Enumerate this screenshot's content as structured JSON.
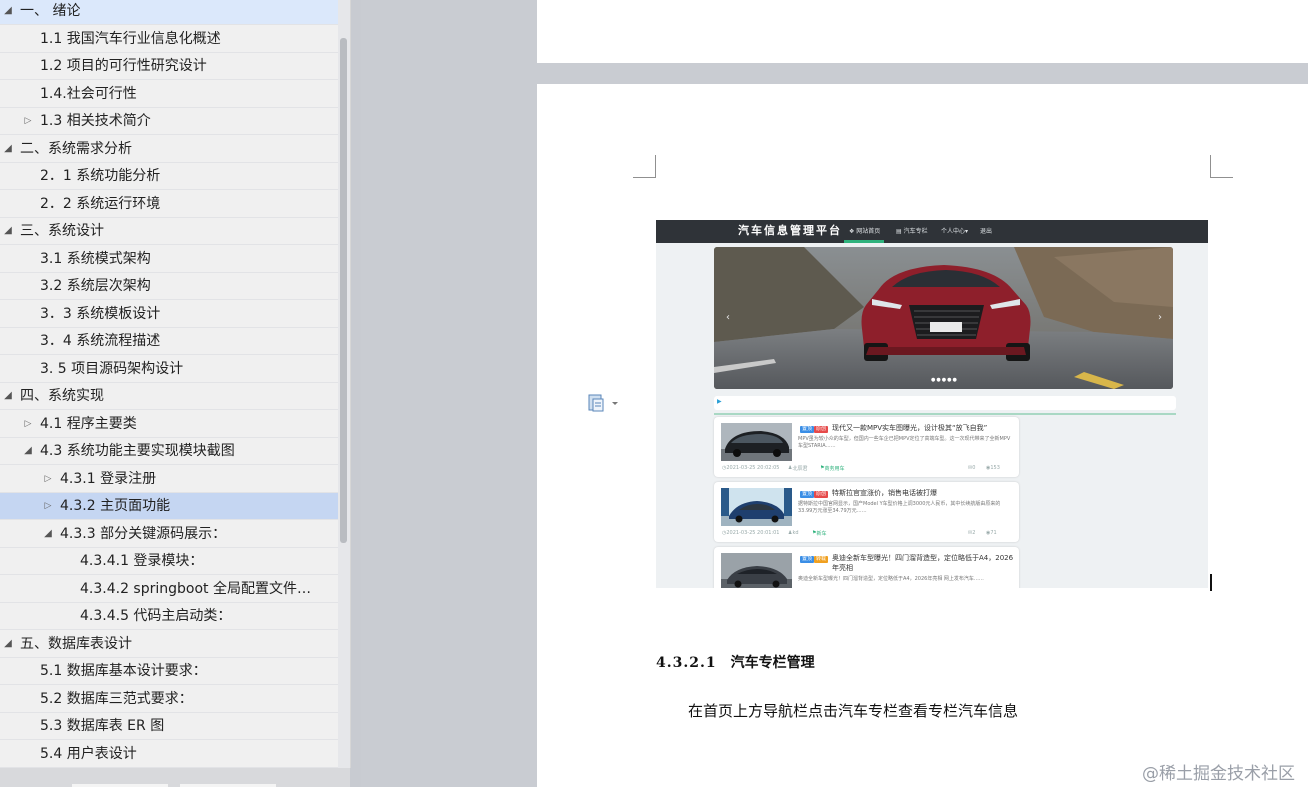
{
  "navigation": {
    "items": [
      {
        "label": "一、 绪论",
        "toggle": "open"
      },
      {
        "label": "1.1  我国汽车行业信息化概述",
        "toggle": "none"
      },
      {
        "label": "1.2 项目的可行性研究设计",
        "toggle": "none"
      },
      {
        "label": "1.4.社会可行性",
        "toggle": "none"
      },
      {
        "label": "1.3 相关技术简介",
        "toggle": "closed"
      },
      {
        "label": "二、系统需求分析",
        "toggle": "open"
      },
      {
        "label": "2．1 系统功能分析",
        "toggle": "none"
      },
      {
        "label": "2．2 系统运行环境",
        "toggle": "none"
      },
      {
        "label": "三、系统设计",
        "toggle": "open"
      },
      {
        "label": "3.1  系统模式架构",
        "toggle": "none"
      },
      {
        "label": "3.2  系统层次架构",
        "toggle": "none"
      },
      {
        "label": "3．3 系统模板设计",
        "toggle": "none"
      },
      {
        "label": "3．4 系统流程描述",
        "toggle": "none"
      },
      {
        "label": "3. 5 项目源码架构设计",
        "toggle": "none"
      },
      {
        "label": "四、系统实现",
        "toggle": "open"
      },
      {
        "label": "4.1  程序主要类",
        "toggle": "closed"
      },
      {
        "label": "4.3 系统功能主要实现模块截图",
        "toggle": "open"
      },
      {
        "label": "4.3.1 登录注册",
        "toggle": "closed"
      },
      {
        "label": "4.3.2  主页面功能",
        "toggle": "closed",
        "selected": true
      },
      {
        "label": "4.3.3 部分关键源码展示：",
        "toggle": "open"
      },
      {
        "label": "4.3.4.1 登录模块：",
        "toggle": "none"
      },
      {
        "label": "4.3.4.2 springboot 全局配置文件…",
        "toggle": "none"
      },
      {
        "label": "4.3.4.5 代码主启动类：",
        "toggle": "none"
      },
      {
        "label": "五、数据库表设计",
        "toggle": "open"
      },
      {
        "label": "5.1 数据库基本设计要求：",
        "toggle": "none"
      },
      {
        "label": "5.2 数据库三范式要求：",
        "toggle": "none"
      },
      {
        "label": "5.3 数据库表 ER 图",
        "toggle": "none"
      },
      {
        "label": "5.4 用户表设计",
        "toggle": "none"
      }
    ]
  },
  "figure": {
    "brand": "汽车信息管理平台",
    "nav": [
      "网站首页",
      "汽车专栏",
      "个人中心▾",
      "退出"
    ],
    "cards": [
      {
        "badges": [
          "置顶",
          "原创"
        ],
        "title": "现代又一款MPV实车图曝光，设计极其“放飞自我”",
        "desc": "MPV虽为较小众的车型，但国内一些车企已把MPV定位了高端车型。这一次现代带来了全新MPV车型STARIA……",
        "date": "2021-03-25 20:02:05",
        "author": "北辰君",
        "tag": "商务用车",
        "comments": "0",
        "views": "153"
      },
      {
        "badges": [
          "置顶",
          "原创"
        ],
        "title": "特斯拉官宣涨价，销售电话被打爆",
        "desc": "据特斯拉中国官网显示，国产Model Y车型价格上调3000元人民币，其中长续航版由原来的33.99万元涨至34.79万元……",
        "date": "2021-03-25 20:01:01",
        "author": "kd",
        "tag": "新车",
        "comments": "2",
        "views": "71"
      },
      {
        "badges": [
          "置顶",
          "转载"
        ],
        "title": "奥迪全新车型曝光！四门溜背造型，定位略低于A4，2026年亮相",
        "desc": "奥迪全新车型曝光！四门溜背造型，定位略低于A4，2026年亮相 网上发布汽车……",
        "date": "",
        "author": "",
        "tag": "",
        "comments": "",
        "views": ""
      }
    ]
  },
  "document": {
    "heading_number": "4.3.2.1",
    "heading_title": "汽车专栏管理",
    "paragraph": "在首页上方导航栏点击汽车专栏查看专栏汽车信息"
  },
  "watermark": "@稀土掘金技术社区",
  "colors": {
    "selected_row": "#c5d6f2",
    "accent_green": "#2fb27d",
    "badge_blue": "#3a8ee6",
    "badge_red": "#e64a4a",
    "badge_orange": "#f0a020"
  },
  "icons": {
    "paste_options": "paste-options-icon",
    "expand": "triangle-down-icon",
    "collapse": "triangle-right-icon"
  }
}
